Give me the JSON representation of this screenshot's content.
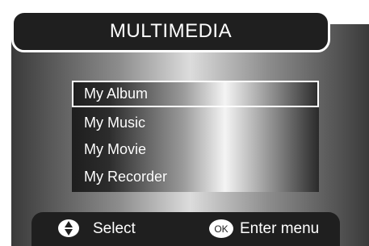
{
  "title": "MULTIMEDIA",
  "menu": {
    "items": [
      {
        "label": "My Album",
        "selected": true
      },
      {
        "label": "My Music",
        "selected": false
      },
      {
        "label": "My Movie",
        "selected": false
      },
      {
        "label": "My Recorder",
        "selected": false
      }
    ]
  },
  "help": {
    "select_icon": "up-down-arrows-icon",
    "select_label": "Select",
    "ok_icon_text": "OK",
    "enter_label": "Enter menu"
  },
  "colors": {
    "bar": "#1f1f1f",
    "text": "#ffffff"
  }
}
